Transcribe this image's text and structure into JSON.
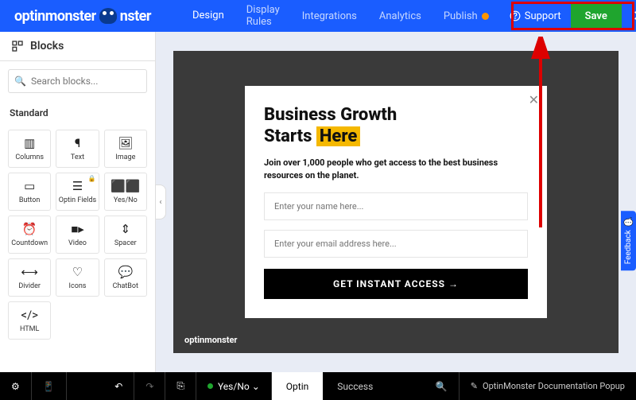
{
  "header": {
    "brand": "optinmonster",
    "nav": [
      "Design",
      "Display Rules",
      "Integrations",
      "Analytics",
      "Publish"
    ],
    "support": "Support",
    "save": "Save"
  },
  "sidebar": {
    "title": "Blocks",
    "search_placeholder": "Search blocks...",
    "section": "Standard",
    "tiles": [
      "Columns",
      "Text",
      "Image",
      "Button",
      "Optin Fields",
      "Yes/No",
      "Countdown",
      "Video",
      "Spacer",
      "Divider",
      "Icons",
      "ChatBot",
      "HTML"
    ]
  },
  "popup": {
    "headline_1": "Business Growth",
    "headline_2a": "Starts ",
    "headline_2b": "Here",
    "sub": "Join over 1,000 people who get access to the best business resources on the planet.",
    "name_ph": "Enter your name here...",
    "email_ph": "Enter your email address here...",
    "cta": "GET INSTANT ACCESS →",
    "mark": "optinmonster"
  },
  "footer": {
    "yesno": "Yes/No",
    "optin": "Optin",
    "success": "Success",
    "campaign": "OptinMonster Documentation Popup"
  },
  "feedback": "Feedback"
}
